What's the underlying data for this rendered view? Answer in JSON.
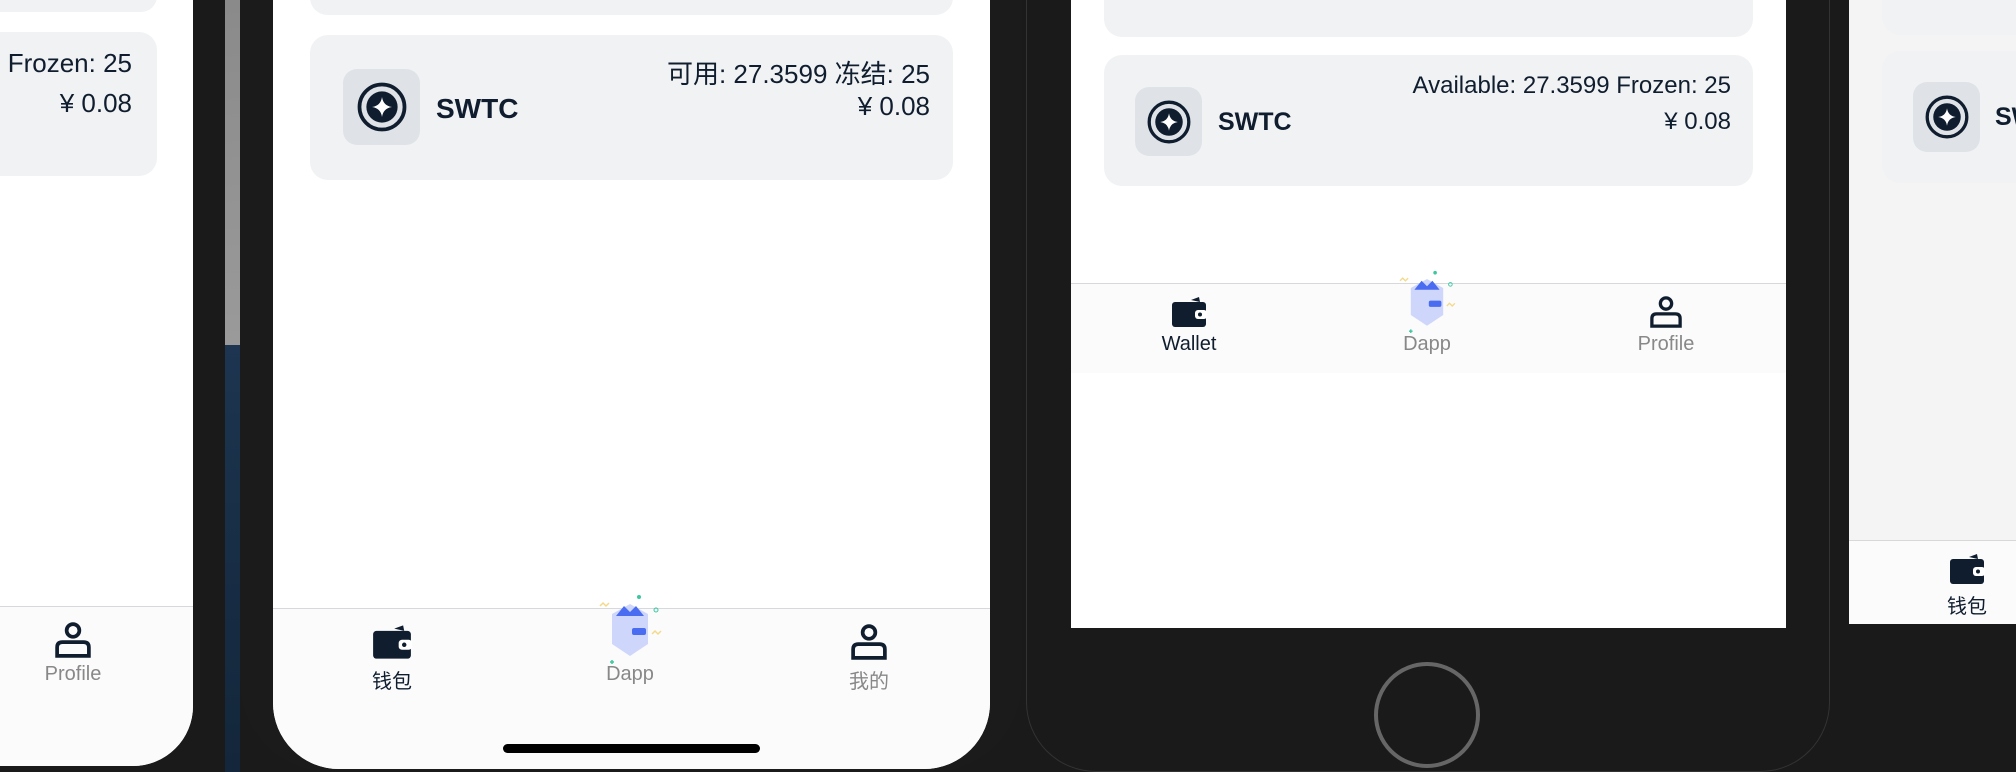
{
  "asset": {
    "name": "SWTC",
    "fiat": "¥ 0.08"
  },
  "phones": [
    {
      "balance_line": "Frozen: 25",
      "fiat": "¥ 0.08",
      "tabs": [
        {
          "label": "Profile",
          "icon": "profile-icon"
        }
      ]
    },
    {
      "balance_line": "可用: 27.3599 冻结: 25",
      "coin": "SWTC",
      "fiat": "¥ 0.08",
      "tabs": [
        {
          "label": "钱包",
          "icon": "wallet-icon",
          "active": true
        },
        {
          "label": "Dapp",
          "icon": "dapp-icon"
        },
        {
          "label": "我的",
          "icon": "profile-icon"
        }
      ]
    },
    {
      "balance_line": "Available: 27.3599 Frozen: 25",
      "coin": "SWTC",
      "fiat": "¥ 0.08",
      "tabs": [
        {
          "label": "Wallet",
          "icon": "wallet-icon",
          "active": true
        },
        {
          "label": "Dapp",
          "icon": "dapp-icon"
        },
        {
          "label": "Profile",
          "icon": "profile-icon"
        }
      ]
    },
    {
      "coin": "SW",
      "tabs": [
        {
          "label": "钱包",
          "icon": "wallet-icon",
          "active": true
        }
      ]
    }
  ],
  "colors": {
    "text": "#0f1d2e",
    "card": "#f1f2f4",
    "muted": "#888888",
    "dapp": "#4a6cf0"
  }
}
